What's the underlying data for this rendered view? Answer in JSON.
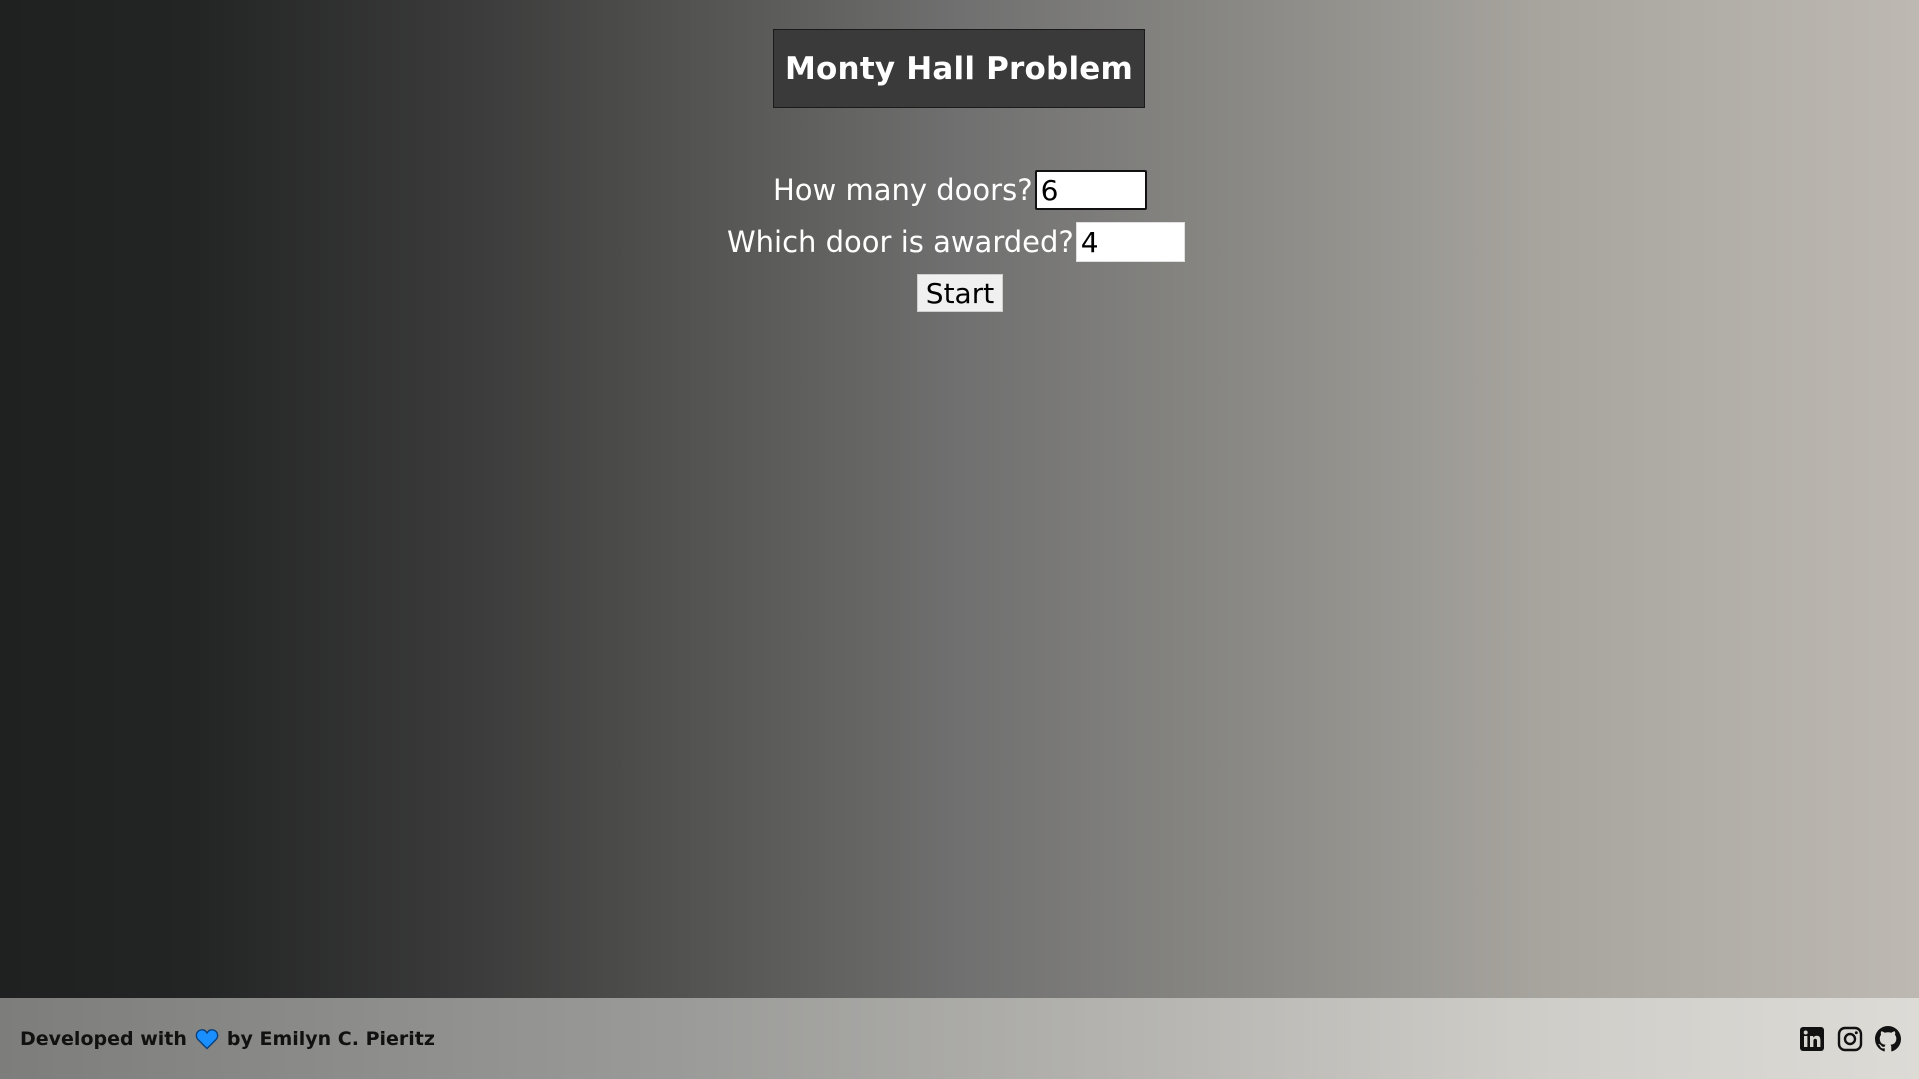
{
  "header": {
    "title": "Monty Hall Problem"
  },
  "form": {
    "doors_label": "How many doors?",
    "doors_value": "6",
    "award_label": "Which door is awarded?",
    "award_value": "4",
    "start_label": "Start"
  },
  "footer": {
    "credit_prefix": "Developed with",
    "credit_icon": "heart-icon",
    "credit_suffix": "by Emilyn C. Pieritz",
    "socials": [
      "linkedin-icon",
      "instagram-icon",
      "github-icon"
    ],
    "heart_color": "#1a8fff"
  }
}
